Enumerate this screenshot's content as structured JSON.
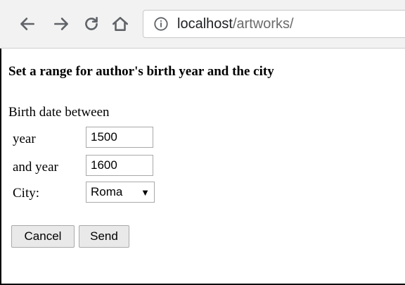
{
  "browser": {
    "url_host": "localhost",
    "url_path": "/artworks/"
  },
  "page": {
    "heading": "Set a range for author's birth year and the city",
    "section_label": "Birth date between",
    "year_label": "year",
    "year_from": "1500",
    "and_year_label": "and year",
    "year_to": "1600",
    "city_label": "City:",
    "city_selected": "Roma",
    "cancel_label": "Cancel",
    "send_label": "Send"
  },
  "icons": [
    "back-icon",
    "forward-icon",
    "reload-icon",
    "home-icon",
    "info-icon",
    "dropdown-caret-icon"
  ]
}
